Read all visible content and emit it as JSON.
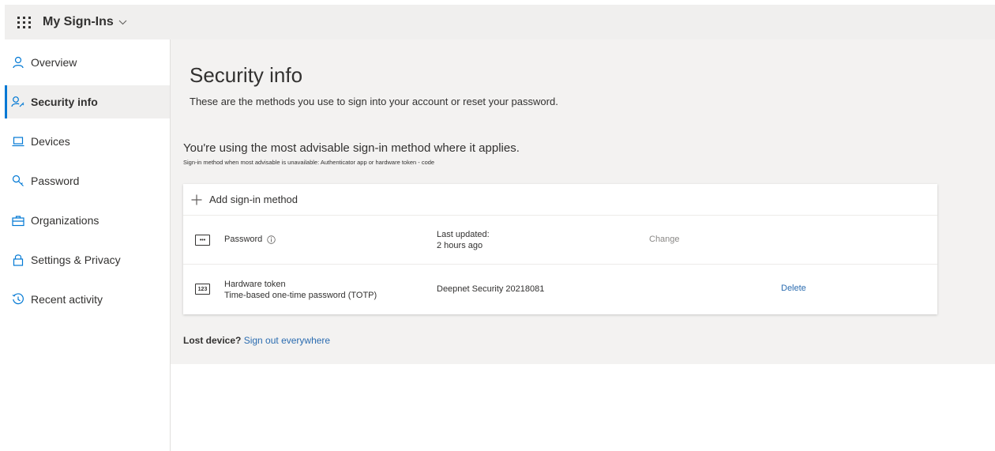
{
  "header": {
    "app_title": "My Sign-Ins"
  },
  "sidebar": {
    "items": [
      {
        "label": "Overview",
        "icon": "person-icon"
      },
      {
        "label": "Security info",
        "icon": "person-key-icon",
        "active": true
      },
      {
        "label": "Devices",
        "icon": "laptop-icon"
      },
      {
        "label": "Password",
        "icon": "key-icon"
      },
      {
        "label": "Organizations",
        "icon": "briefcase-icon"
      },
      {
        "label": "Settings & Privacy",
        "icon": "lock-icon"
      },
      {
        "label": "Recent activity",
        "icon": "history-icon"
      }
    ]
  },
  "main": {
    "title": "Security info",
    "subtitle": "These are the methods you use to sign into your account or reset your password.",
    "advisable_heading": "You're using the most advisable sign-in method where it applies.",
    "advisable_note": "Sign-in method when most advisable is unavailable: Authenticator app or hardware token - code",
    "add_method_label": "Add sign-in method",
    "methods": [
      {
        "icon": "password-dots-icon",
        "icon_text": "•••",
        "name": "Password",
        "detail_line1": "Last updated:",
        "detail_line2": "2 hours ago",
        "action": "Change",
        "action_color": "#8a8886"
      },
      {
        "icon": "hardware-token-icon",
        "icon_text": "123",
        "name": "Hardware token",
        "name_line2": "Time-based one-time password (TOTP)",
        "detail_line1": "Deepnet Security 20218081",
        "action": "Delete",
        "action_color": "#2b6cb0"
      }
    ],
    "lost_device_question": "Lost device?",
    "sign_out_link": "Sign out everywhere"
  },
  "colors": {
    "accent": "#0078d4",
    "link": "#2b6cb0",
    "muted_action": "#8a8886"
  }
}
